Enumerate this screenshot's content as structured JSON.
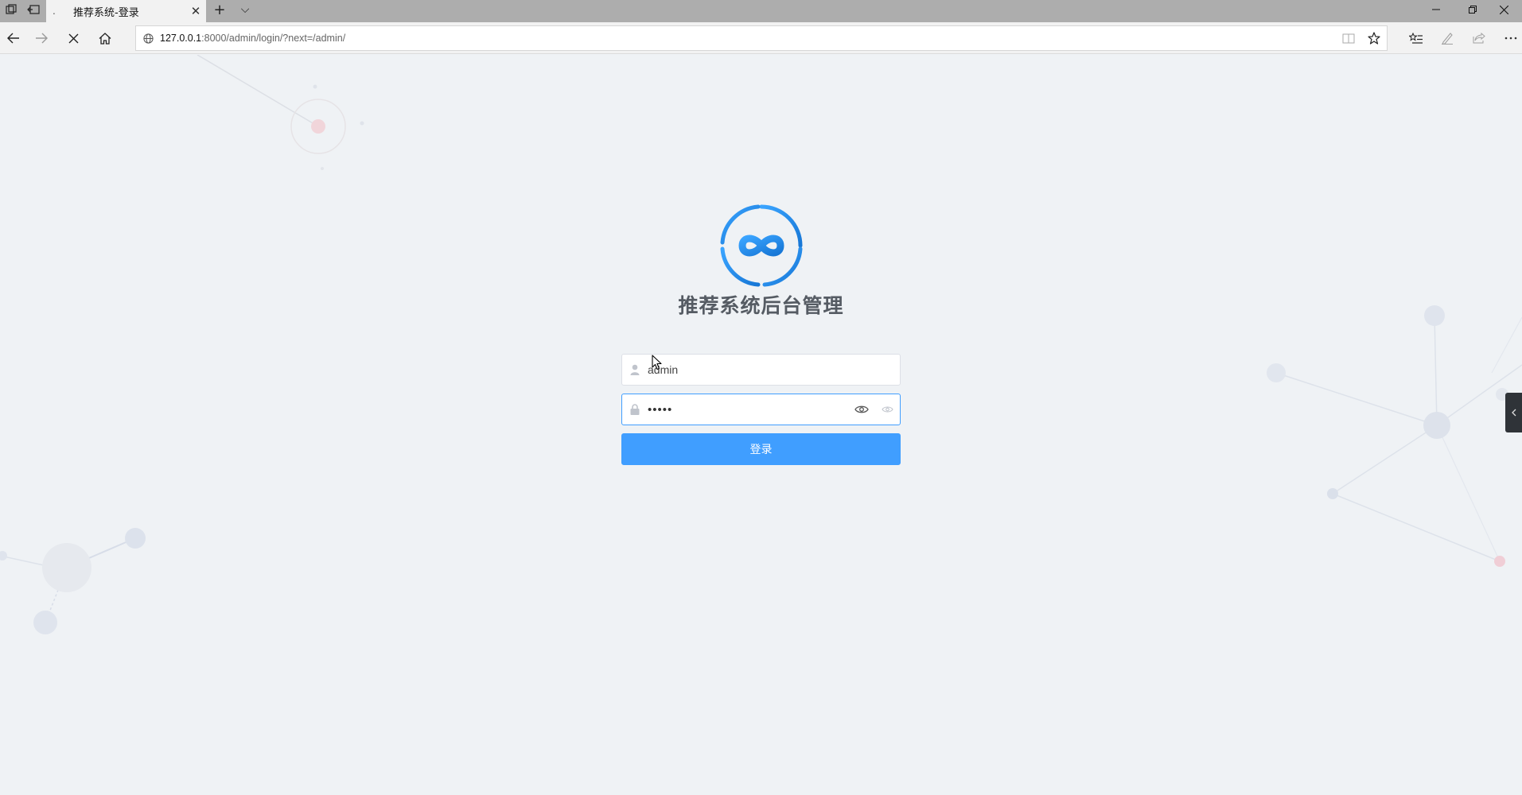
{
  "browser": {
    "tab": {
      "title": "推荐系统-登录",
      "loading_icon": "spinner-icon",
      "close_glyph": "✕"
    },
    "new_tab_glyph": "+",
    "tab_list_glyph": "⌵",
    "address": {
      "host": "127.0.0.1",
      "path": ":8000/admin/login/?next=/admin/"
    },
    "window_controls": {
      "minimize": "—",
      "restore": "❐",
      "close": "✕"
    }
  },
  "login": {
    "title": "推荐系统后台管理",
    "username_value": "admin",
    "password_value": "•••••",
    "submit_label": "登录"
  },
  "colors": {
    "accent": "#409eff",
    "background": "#eff2f5",
    "logo_blue": "#2a8bee"
  }
}
